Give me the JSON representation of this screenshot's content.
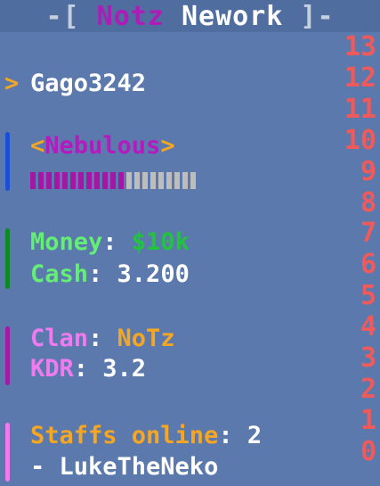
{
  "header": {
    "left_bracket": "-[",
    "brand": "Notz",
    "brand_rest": "Nework",
    "right_bracket": "]-"
  },
  "player": {
    "arrow": ">",
    "name": "Gago3242"
  },
  "rank": {
    "open": "<",
    "name": "Nebulous",
    "close": ">",
    "progress_filled": 12,
    "progress_total": 21,
    "progress_fraction": 0.57
  },
  "economy": {
    "money_label": "Money",
    "money_value": "$10k",
    "cash_label": "Cash",
    "cash_value": "3.200"
  },
  "clan": {
    "clan_label": "Clan",
    "clan_value": "NoTz",
    "kdr_label": "KDR",
    "kdr_value": "3.2"
  },
  "staff": {
    "label": "Staffs online",
    "count": "2",
    "entry": "- LukeTheNeko"
  },
  "score_numbers": [
    "13",
    "12",
    "11",
    "10",
    "9",
    "8",
    "7",
    "6",
    "5",
    "4",
    "3",
    "2",
    "1",
    "0"
  ],
  "colors": {
    "background": "#5b79ad",
    "score_red": "#f05a5a",
    "purple": "#b51abf",
    "green": "#63ee74",
    "orange": "#f5a623",
    "pink": "#f07aef"
  }
}
